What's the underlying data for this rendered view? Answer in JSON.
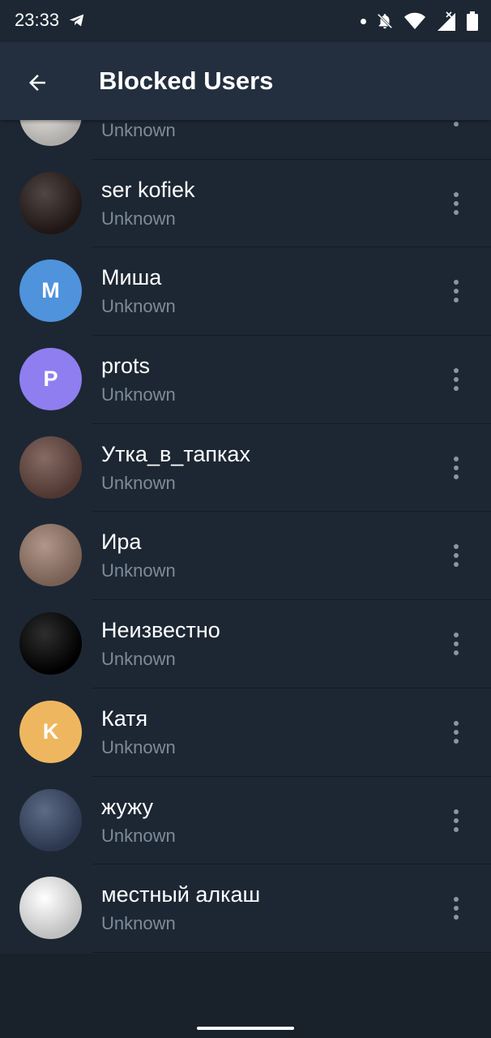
{
  "status_bar": {
    "time": "23:33"
  },
  "header": {
    "title": "Blocked Users"
  },
  "users": [
    {
      "name": "",
      "status": "Unknown",
      "avatar_type": "photo",
      "avatar_letter": "",
      "avatar_color": "#e8e5e0"
    },
    {
      "name": "ser kofiek",
      "status": "Unknown",
      "avatar_type": "photo",
      "avatar_letter": "",
      "avatar_color": "#2a1e1c"
    },
    {
      "name": "Миша",
      "status": "Unknown",
      "avatar_type": "letter",
      "avatar_letter": "M",
      "avatar_color": "#4f93dc"
    },
    {
      "name": "prots",
      "status": "Unknown",
      "avatar_type": "letter",
      "avatar_letter": "P",
      "avatar_color": "#8f7ef0"
    },
    {
      "name": "Утка_в_тапках",
      "status": "Unknown",
      "avatar_type": "photo",
      "avatar_letter": "",
      "avatar_color": "#6b4a42"
    },
    {
      "name": "Ира",
      "status": "Unknown",
      "avatar_type": "photo",
      "avatar_letter": "",
      "avatar_color": "#a08070"
    },
    {
      "name": "Неизвестно",
      "status": "Unknown",
      "avatar_type": "photo",
      "avatar_letter": "",
      "avatar_color": "#000000"
    },
    {
      "name": "Катя",
      "status": "Unknown",
      "avatar_type": "letter",
      "avatar_letter": "K",
      "avatar_color": "#eeb75f"
    },
    {
      "name": "жужу",
      "status": "Unknown",
      "avatar_type": "photo",
      "avatar_letter": "",
      "avatar_color": "#3a4a6a"
    },
    {
      "name": "местный алкаш",
      "status": "Unknown",
      "avatar_type": "photo",
      "avatar_letter": "",
      "avatar_color": "#ffffff"
    }
  ]
}
